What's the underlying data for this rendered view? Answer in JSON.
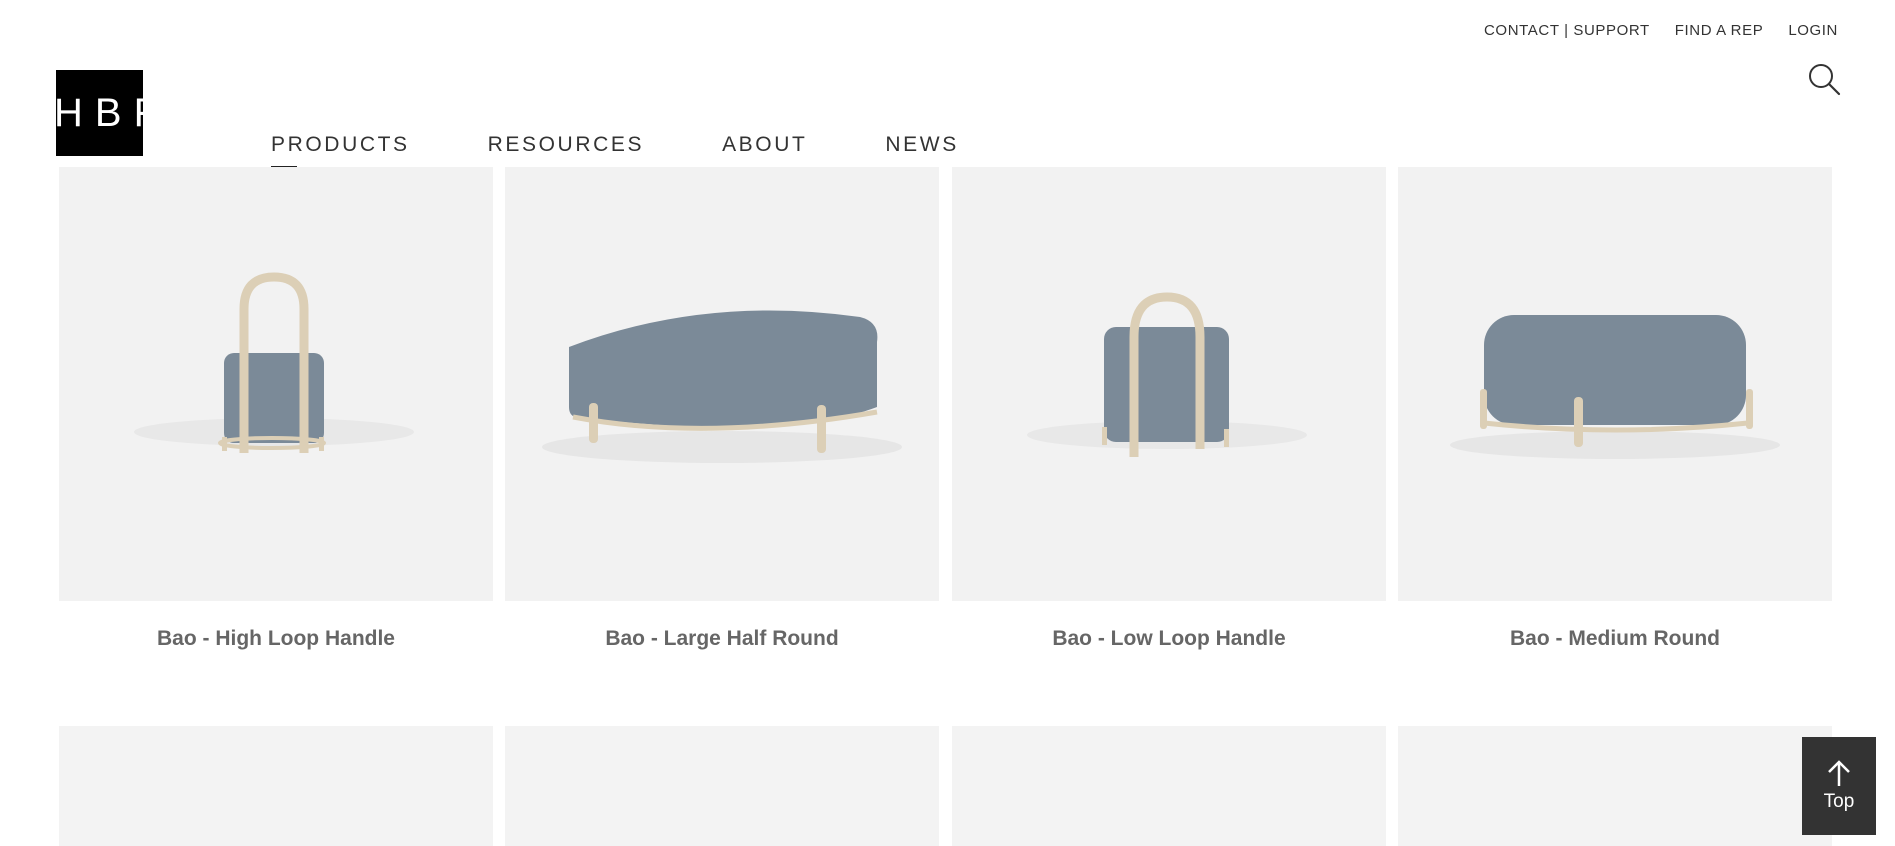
{
  "utility_nav": [
    "CONTACT | SUPPORT",
    "FIND A REP",
    "LOGIN"
  ],
  "logo_text": "HBF",
  "main_nav": [
    "PRODUCTS",
    "RESOURCES",
    "ABOUT",
    "NEWS"
  ],
  "products": [
    {
      "name": "Bao - High Loop Handle"
    },
    {
      "name": "Bao - Large Half Round"
    },
    {
      "name": "Bao - Low Loop Handle"
    },
    {
      "name": "Bao - Medium Round"
    }
  ],
  "back_to_top_label": "Top",
  "icons": [
    "search-icon",
    "arrow-up-icon"
  ],
  "colors": {
    "upholstery": "#7b8a98",
    "wood": "#dccfb6",
    "tile_bg": "#f2f2f2",
    "top_button": "#333333"
  }
}
